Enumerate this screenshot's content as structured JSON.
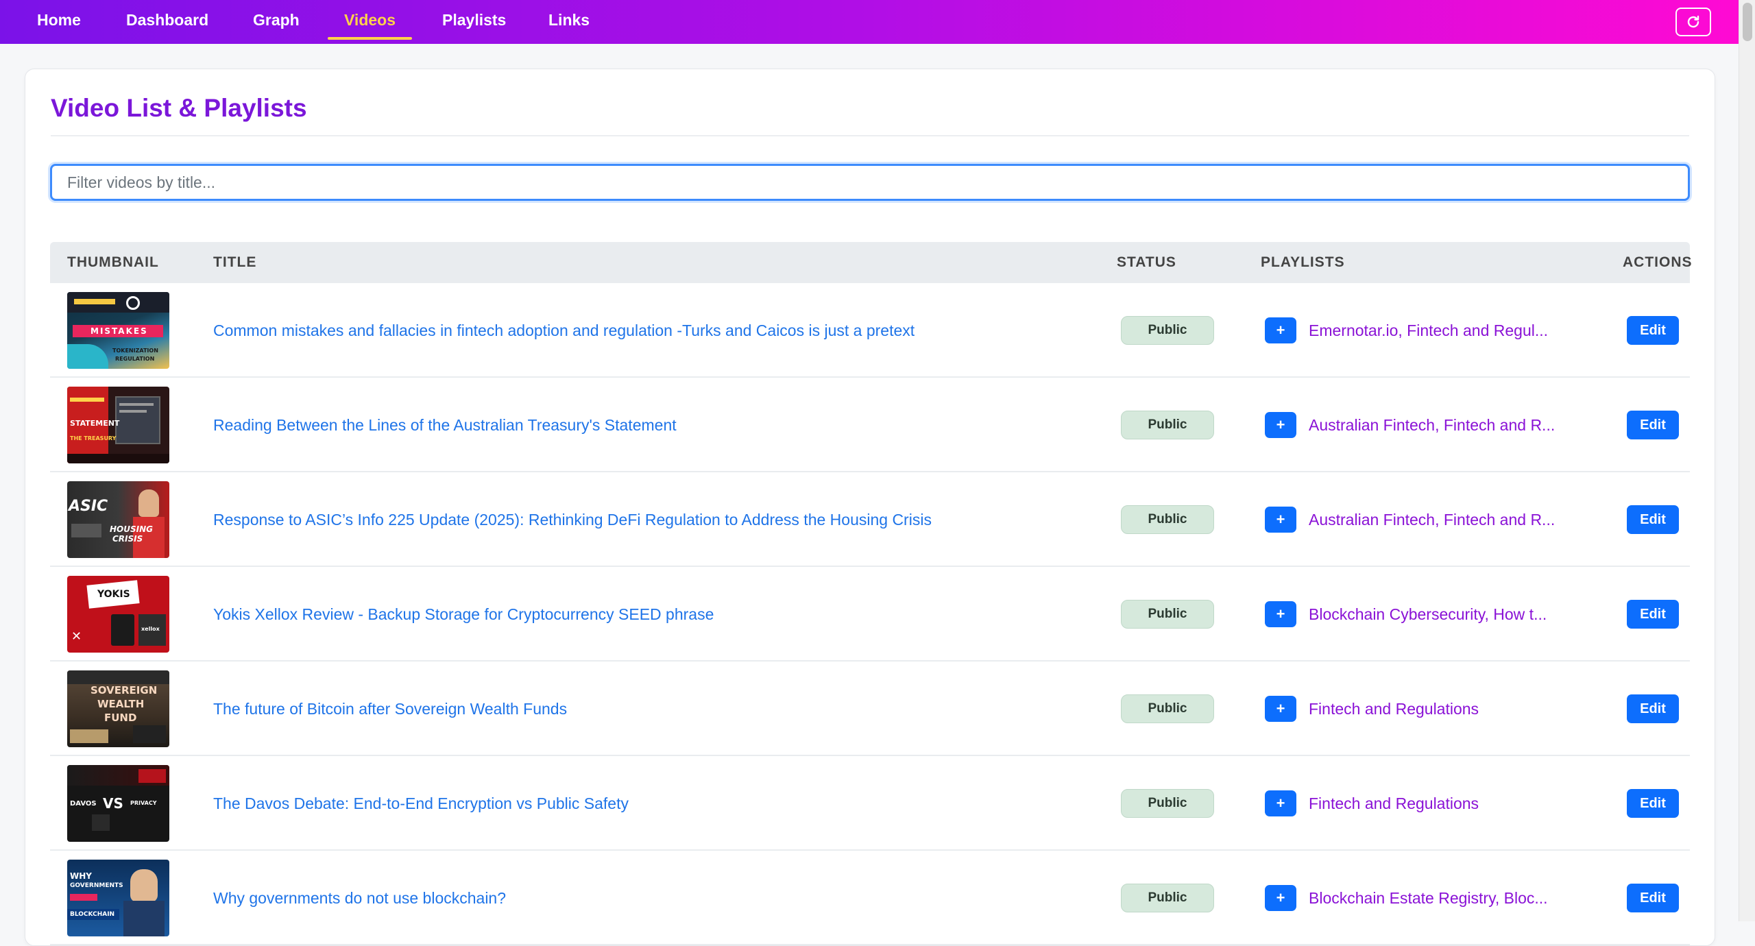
{
  "nav": {
    "items": [
      {
        "label": "Home",
        "active": false
      },
      {
        "label": "Dashboard",
        "active": false
      },
      {
        "label": "Graph",
        "active": false
      },
      {
        "label": "Videos",
        "active": true
      },
      {
        "label": "Playlists",
        "active": false
      },
      {
        "label": "Links",
        "active": false
      }
    ],
    "refresh_icon": "refresh-icon"
  },
  "page": {
    "title": "Video List & Playlists"
  },
  "search": {
    "placeholder": "Filter videos by title..."
  },
  "table": {
    "headers": {
      "thumbnail": "THUMBNAIL",
      "title": "TITLE",
      "status": "STATUS",
      "playlists": "PLAYLISTS",
      "actions": "ACTIONS"
    },
    "add_label": "+",
    "edit_label": "Edit",
    "rows": [
      {
        "title": "Common mistakes and fallacies in fintech adoption and regulation -Turks and Caicos is just a pretext",
        "status": "Public",
        "playlists": "Emernotar.io, Fintech and Regul...",
        "thumb_texts": [
          "MISTAKES",
          "TOKENIZATION",
          "REGULATION"
        ]
      },
      {
        "title": "Reading Between the Lines of the Australian Treasury's Statement",
        "status": "Public",
        "playlists": "Australian Fintech, Fintech and R...",
        "thumb_texts": [
          "STATEMENT",
          "THE TREASURY"
        ]
      },
      {
        "title": "Response to ASIC’s Info 225 Update (2025): Rethinking DeFi Regulation to Address the Housing Crisis",
        "status": "Public",
        "playlists": "Australian Fintech, Fintech and R...",
        "thumb_texts": [
          "ASIC",
          "HOUSING",
          "CRISIS"
        ]
      },
      {
        "title": "Yokis Xellox Review - Backup Storage for Cryptocurrency SEED phrase",
        "status": "Public",
        "playlists": "Blockchain Cybersecurity, How t...",
        "thumb_texts": [
          "YOKIS",
          "xellox"
        ]
      },
      {
        "title": "The future of Bitcoin after Sovereign Wealth Funds",
        "status": "Public",
        "playlists": "Fintech and Regulations",
        "thumb_texts": [
          "SOVEREIGN",
          "WEALTH",
          "FUND"
        ]
      },
      {
        "title": "The Davos Debate: End-to-End Encryption vs Public Safety",
        "status": "Public",
        "playlists": "Fintech and Regulations",
        "thumb_texts": [
          "DAVOS",
          "VS",
          "PRIVACY"
        ]
      },
      {
        "title": "Why governments do not use blockchain?",
        "status": "Public",
        "playlists": "Blockchain Estate Registry, Bloc...",
        "thumb_texts": [
          "WHY",
          "GOVERNMENTS",
          "BLOCKCHAIN"
        ]
      }
    ]
  },
  "colors": {
    "nav_gradient_start": "#7b12e8",
    "nav_gradient_end": "#ff0ad3",
    "active_nav": "#ffd24a",
    "title": "#7b17d9",
    "link_blue": "#1f74e8",
    "playlist_purple": "#8a12d6",
    "button_blue": "#0d6efd",
    "badge_green": "#d6e9dc"
  }
}
